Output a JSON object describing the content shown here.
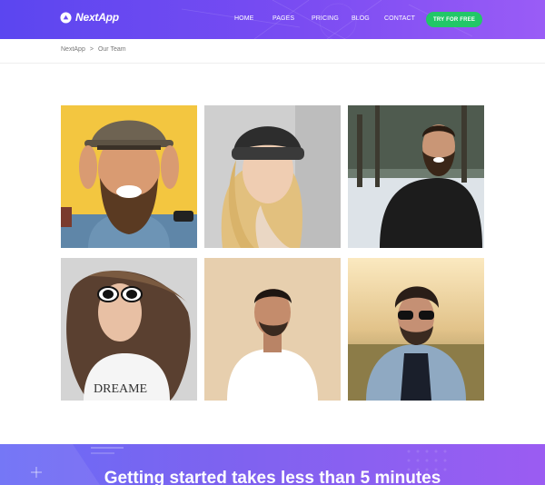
{
  "brand": {
    "name": "NextApp"
  },
  "nav": {
    "items": [
      {
        "label": "HOME"
      },
      {
        "label": "PAGES"
      },
      {
        "label": "PRICING"
      },
      {
        "label": "BLOG"
      },
      {
        "label": "CONTACT"
      }
    ],
    "cta_label": "TRY FOR FREE"
  },
  "breadcrumb": {
    "home": "NextApp",
    "separator": ">",
    "current": "Our Team"
  },
  "team": {
    "photos": [
      {
        "icon": "bearded-man-hat-photo",
        "bg": "#f3c640"
      },
      {
        "icon": "woman-beanie-photo",
        "bg": "#cfcfcf"
      },
      {
        "icon": "man-black-coat-photo",
        "bg": "#8a9aa3"
      },
      {
        "icon": "woman-sunglasses-photo",
        "bg": "#d4d4d4"
      },
      {
        "icon": "man-white-tshirt-photo",
        "bg": "#e7cfae"
      },
      {
        "icon": "man-denim-jacket-photo",
        "bg": "#d9b779"
      }
    ]
  },
  "banner": {
    "title": "Getting started takes less than 5 minutes"
  },
  "colors": {
    "header_start": "#5b46f0",
    "header_end": "#9a5cf6",
    "cta": "#22c768"
  }
}
